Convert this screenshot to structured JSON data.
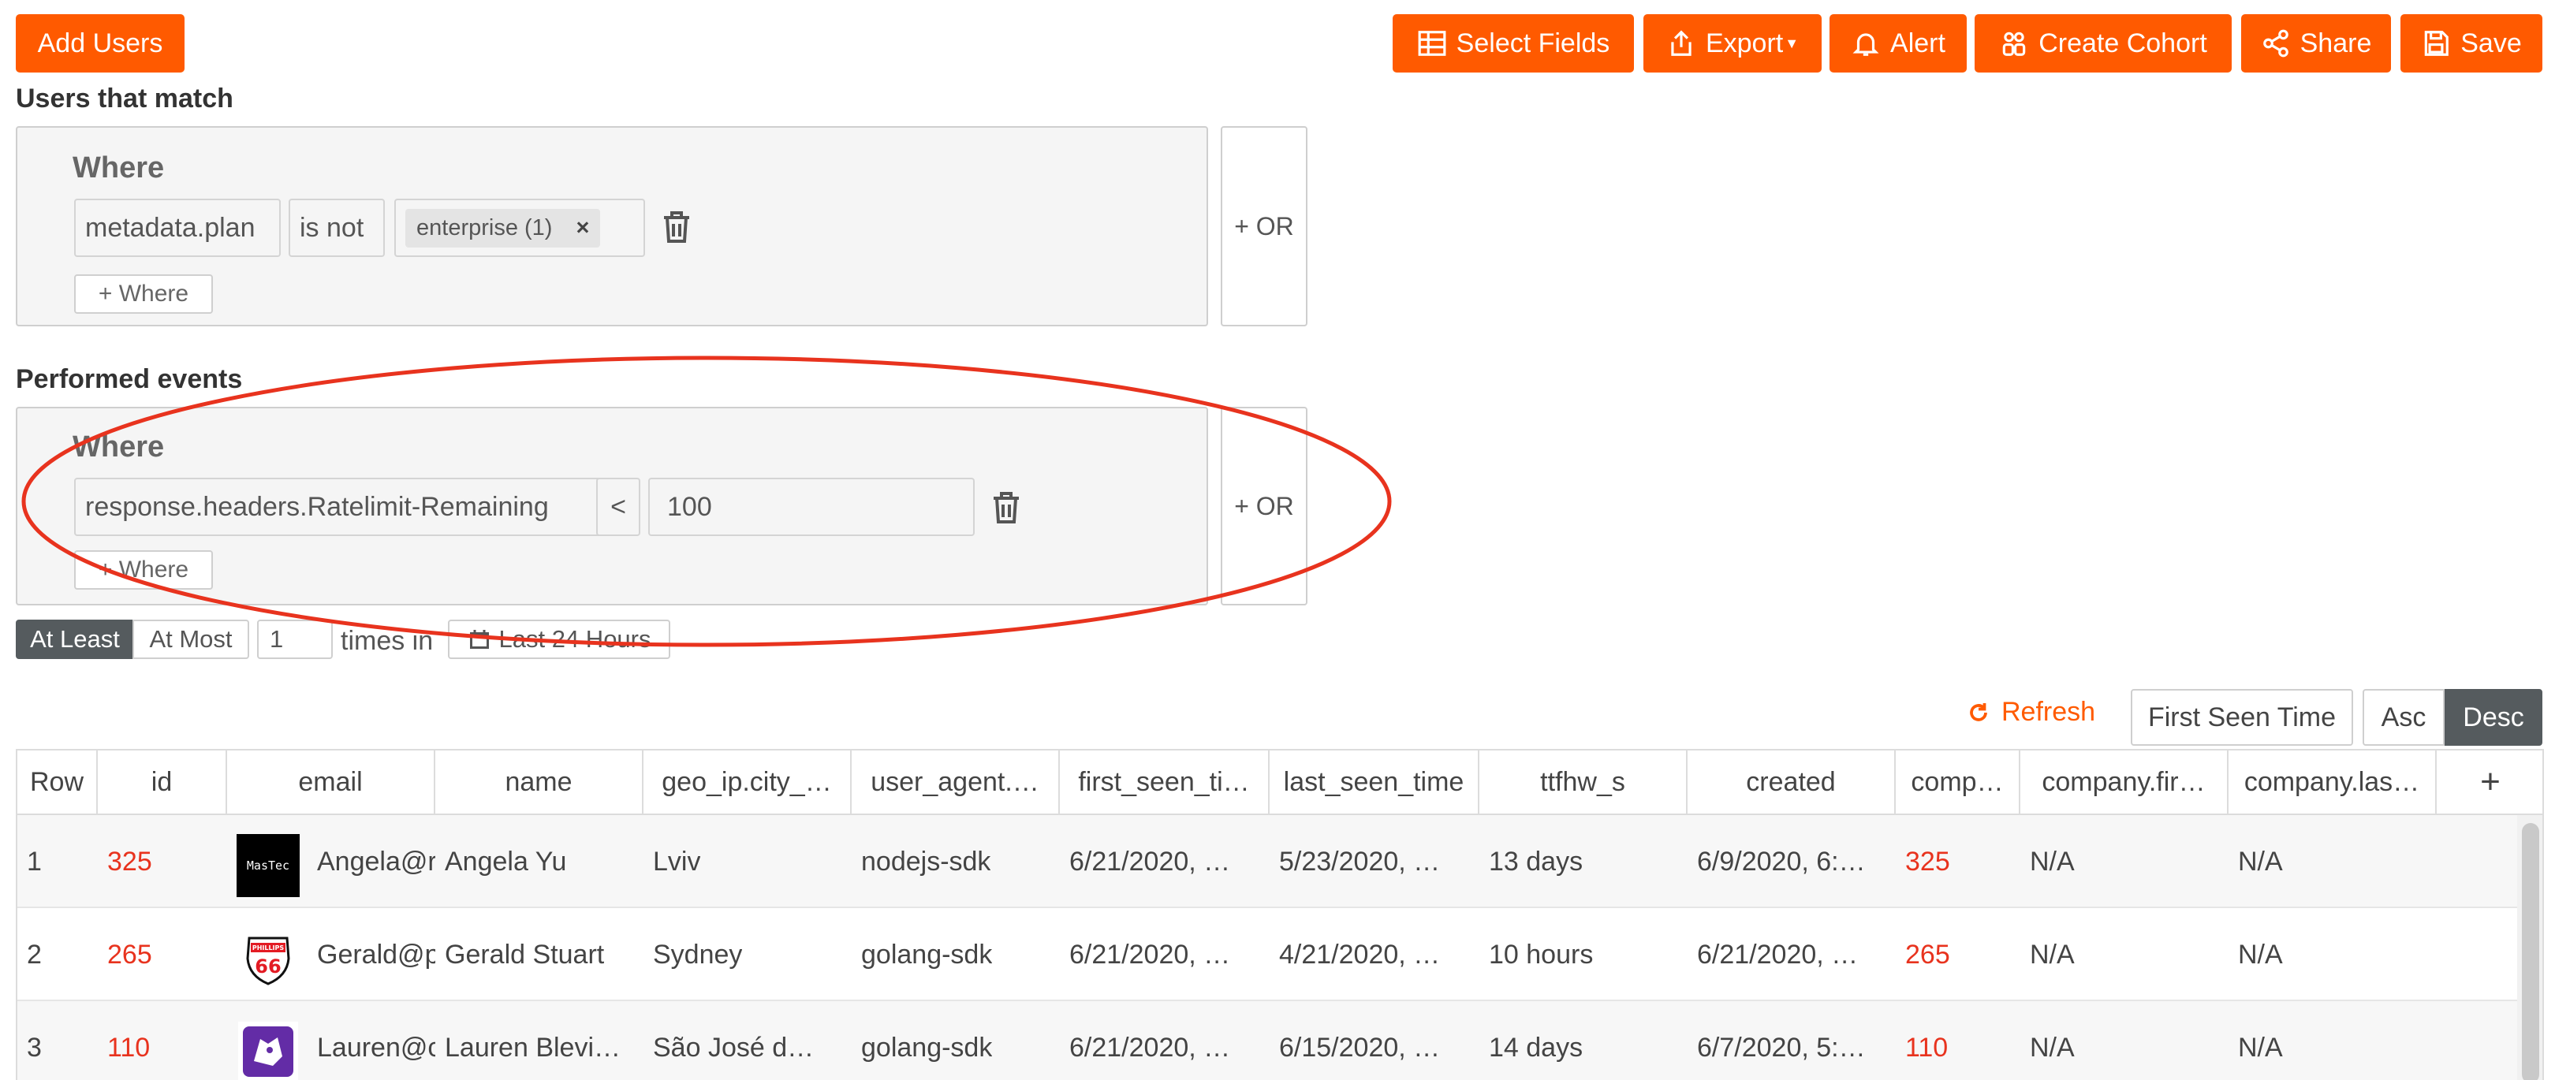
{
  "toolbar": {
    "add_users": "Add Users",
    "select_fields": "Select Fields",
    "export": "Export",
    "alert": "Alert",
    "create_cohort": "Create Cohort",
    "share": "Share",
    "save": "Save"
  },
  "users_match": {
    "title": "Users that match",
    "where": "Where",
    "field": "metadata.plan",
    "operator": "is not",
    "value_tag": "enterprise (1)",
    "tag_close": "×",
    "add_where": "+ Where",
    "or": "+ OR"
  },
  "performed_events": {
    "title": "Performed events",
    "where": "Where",
    "field": "response.headers.Ratelimit-Remaining",
    "operator": "<",
    "value": "100",
    "add_where": "+ Where",
    "or": "+ OR",
    "at_least": "At Least",
    "at_most": "At Most",
    "times_value": "1",
    "times_in": "times in",
    "time_range": "Last 24 Hours"
  },
  "results": {
    "refresh": "Refresh",
    "sort_field": "First Seen Time",
    "asc": "Asc",
    "desc": "Desc",
    "add_column": "+",
    "columns": [
      "Row",
      "id",
      "email",
      "name",
      "geo_ip.city_…",
      "user_agent.…",
      "first_seen_ti…",
      "last_seen_time",
      "ttfhw_s",
      "created",
      "comp…",
      "company.fir…",
      "company.las…"
    ],
    "rows": [
      {
        "row": "1",
        "id": "325",
        "email": "Angela@r",
        "name": "Angela Yu",
        "city": "Lviv",
        "agent": "nodejs-sdk",
        "first_seen": "6/21/2020, …",
        "last_seen": "5/23/2020, …",
        "ttfhw": "13 days",
        "created": "6/9/2020, 6:…",
        "comp": "325",
        "company_first": "N/A",
        "company_last": "N/A",
        "logo_text": "MasTec"
      },
      {
        "row": "2",
        "id": "265",
        "email": "Gerald@p",
        "name": "Gerald Stuart",
        "city": "Sydney",
        "agent": "golang-sdk",
        "first_seen": "6/21/2020, …",
        "last_seen": "4/21/2020, …",
        "ttfhw": "10 hours",
        "created": "6/21/2020, …",
        "comp": "265",
        "company_first": "N/A",
        "company_last": "N/A",
        "logo_text": "PHILLIPS 66"
      },
      {
        "row": "3",
        "id": "110",
        "email": "Lauren@c",
        "name": "Lauren Blevi…",
        "city": "São José d…",
        "agent": "golang-sdk",
        "first_seen": "6/21/2020, …",
        "last_seen": "6/15/2020, …",
        "ttfhw": "14 days",
        "created": "6/7/2020, 5:…",
        "comp": "110",
        "company_first": "N/A",
        "company_last": "N/A",
        "logo_text": ""
      }
    ]
  },
  "colors": {
    "accent": "#ff5a00",
    "annotation": "#e8331e",
    "selected_dark": "#555b5e"
  }
}
